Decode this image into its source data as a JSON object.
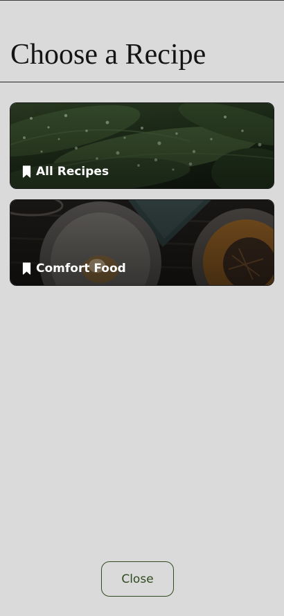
{
  "header": {
    "title": "Choose a Recipe"
  },
  "collections": [
    {
      "label": "All Recipes",
      "icon": "bookmark-icon",
      "image": "water-droplets-on-leaves"
    },
    {
      "label": "Comfort Food",
      "icon": "bookmark-icon",
      "image": "plated-dishes-on-table"
    }
  ],
  "footer": {
    "close_label": "Close"
  },
  "colors": {
    "background": "#dadada",
    "title_text": "#141414",
    "card_label": "#ffffff",
    "close_button_accent": "#2f4a1f"
  }
}
